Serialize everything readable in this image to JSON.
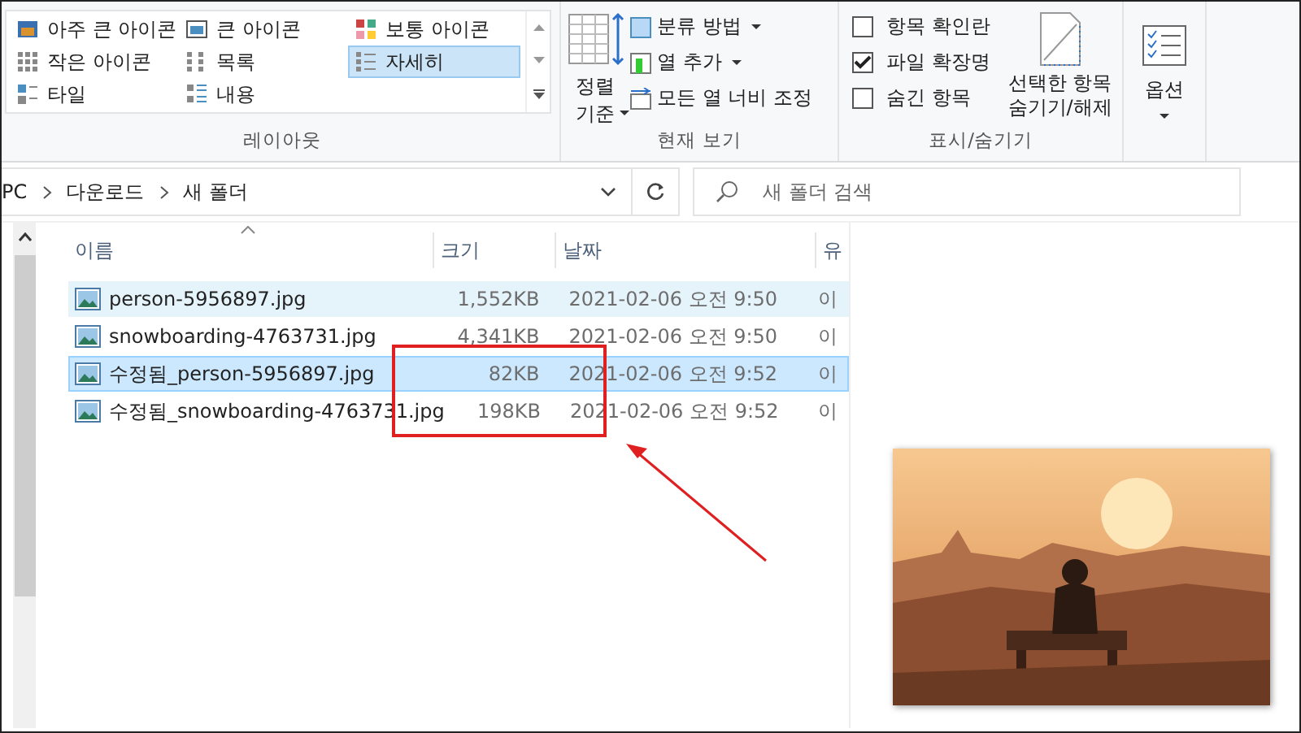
{
  "ribbon": {
    "layout": {
      "title": "레이아웃",
      "items": [
        {
          "label": "아주 큰 아이콘",
          "selected": false
        },
        {
          "label": "큰 아이콘",
          "selected": false
        },
        {
          "label": "보통 아이콘",
          "selected": false
        },
        {
          "label": "작은 아이콘",
          "selected": false
        },
        {
          "label": "목록",
          "selected": false
        },
        {
          "label": "자세히",
          "selected": true
        },
        {
          "label": "타일",
          "selected": false
        },
        {
          "label": "내용",
          "selected": false
        }
      ]
    },
    "current_view": {
      "title": "현재 보기",
      "sort_button": "정렬 기준",
      "items": [
        {
          "label": "분류 방법",
          "dropdown": true
        },
        {
          "label": "열 추가",
          "dropdown": true
        },
        {
          "label": "모든 열 너비 조정",
          "dropdown": false
        }
      ]
    },
    "show_hide": {
      "title": "표시/숨기기",
      "checkboxes": [
        {
          "label": "항목 확인란",
          "checked": false
        },
        {
          "label": "파일 확장명",
          "checked": true
        },
        {
          "label": "숨긴 항목",
          "checked": false
        }
      ],
      "hide_button": "선택한 항목 숨기기/해제"
    },
    "options": {
      "label": "옵션"
    }
  },
  "address_bar": {
    "path": [
      "PC",
      "다운로드",
      "새 폴더"
    ]
  },
  "search": {
    "placeholder": "새 폴더 검색"
  },
  "table": {
    "columns": [
      "이름",
      "크기",
      "날짜",
      "유"
    ],
    "rows": [
      {
        "name": "person-5956897.jpg",
        "size": "1,552KB",
        "date": "2021-02-06 오전 9:50",
        "type": "이",
        "selected": false,
        "hovered": true
      },
      {
        "name": "snowboarding-4763731.jpg",
        "size": "4,341KB",
        "date": "2021-02-06 오전 9:50",
        "type": "이",
        "selected": false,
        "hovered": false
      },
      {
        "name": "수정됨_person-5956897.jpg",
        "size": "82KB",
        "date": "2021-02-06 오전 9:52",
        "type": "이",
        "selected": true,
        "hovered": false
      },
      {
        "name": "수정됨_snowboarding-4763731.jpg",
        "size": "198KB",
        "date": "2021-02-06 오전 9:52",
        "type": "이",
        "selected": false,
        "hovered": false
      }
    ]
  }
}
